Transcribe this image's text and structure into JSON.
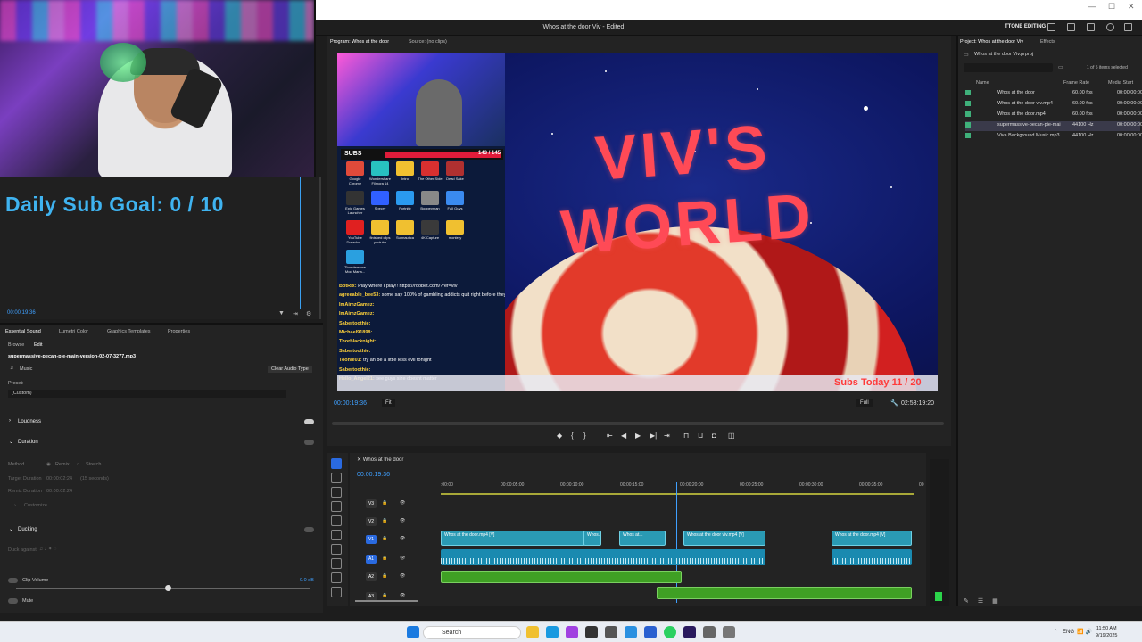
{
  "webcam": {
    "logo_text": "SUBGOAL"
  },
  "left_overlay": {
    "sub_goal": "Daily Sub Goal:  0 / 10",
    "timecode": "00:00:19:36"
  },
  "window": {
    "title": "Whos at the door Viv - Edited",
    "workspace": "TTONE EDITING"
  },
  "program": {
    "tab_program": "Program: Whos at the door",
    "tab_source": "Source: (no clips)",
    "timecode": "00:00:19:36",
    "fit": "Fit",
    "quality": "Full",
    "duration": "02:53:19:20"
  },
  "video_overlay": {
    "title_text": "VIV'S WORLD",
    "subs_label": "SUBS",
    "subs_count": "143 / 145",
    "subs_today": "Subs Today  11 / 20",
    "desktop_icons": [
      {
        "label": "Google Chrome",
        "color": "#e04a3a"
      },
      {
        "label": "Wondershare Filmora 14",
        "color": "#28c0c0"
      },
      {
        "label": "Intro",
        "color": "#f0c030"
      },
      {
        "label": "The Other Side",
        "color": "#d83030"
      },
      {
        "label": "Dead Sake",
        "color": "#b03030"
      },
      {
        "label": "Epic Games Launcher",
        "color": "#333"
      },
      {
        "label": "Specry",
        "color": "#3060ff"
      },
      {
        "label": "Fortnite",
        "color": "#2a9af0"
      },
      {
        "label": "Boogeyman",
        "color": "#888"
      },
      {
        "label": "Fall Guys",
        "color": "#3a8af0"
      },
      {
        "label": "YouTube Downloa...",
        "color": "#e02020"
      },
      {
        "label": "finished clips youtube",
        "color": "#f0c030"
      },
      {
        "label": "Subnautica",
        "color": "#f0c030"
      },
      {
        "label": "4K Capture",
        "color": "#3a3a3a"
      },
      {
        "label": "montery",
        "color": "#f0c030"
      },
      {
        "label": "Thunderstore Mod Mana...",
        "color": "#2aa0e0"
      }
    ],
    "chat": [
      {
        "user": "BotRix",
        "msg": "Play where I play!! https://roobet.com/?ref=viv"
      },
      {
        "user": "agreeable_bee53",
        "msg": "some say 100% of gambling addicts quit right before they win big"
      },
      {
        "user": "ImAimzGamez",
        "msg": ""
      },
      {
        "user": "ImAimzGamez",
        "msg": ""
      },
      {
        "user": "Sabertoothie",
        "msg": ""
      },
      {
        "user": "Michael91898",
        "msg": ""
      },
      {
        "user": "Thorblacknight",
        "msg": ""
      },
      {
        "user": "Sabertoothie",
        "msg": ""
      },
      {
        "user": "Toonle01",
        "msg": "try an be a little less evil tonight"
      },
      {
        "user": "Sabertoothie",
        "msg": ""
      },
      {
        "user": "Hello_Angel21",
        "msg": "see guys size doesnt matter"
      }
    ]
  },
  "project": {
    "tab": "Project: Whos at the door Viv",
    "tab_effects": "Effects",
    "file": "Whos at the door Viv.prproj",
    "selection": "1 of 5 items selected",
    "col_name": "Name",
    "col_rate": "Frame Rate",
    "col_start": "Media Start",
    "items": [
      {
        "name": "Whos at the door",
        "rate": "60.00 fps",
        "start": "00:00:00:00"
      },
      {
        "name": "Whos at the door viv.mp4",
        "rate": "60.00 fps",
        "start": "00:00:00:00"
      },
      {
        "name": "Whos at the door.mp4",
        "rate": "60.00 fps",
        "start": "00:00:00:00"
      },
      {
        "name": "supermassive-pecan-pie-mai",
        "rate": "44100 Hz",
        "start": "00:00:00:00"
      },
      {
        "name": "Viva Background Music.mp3",
        "rate": "44100 Hz",
        "start": "00:00:00:00"
      }
    ]
  },
  "essential_sound": {
    "tabs": [
      "Essential Sound",
      "Lumetri Color",
      "Graphics Templates",
      "Properties"
    ],
    "subtab_browse": "Browse",
    "subtab_edit": "Edit",
    "clip_name": "supermassive-pecan-pie-main-version-02-07-3277.mp3",
    "type": "Music",
    "clear_btn": "Clear Audio Type",
    "preset_label": "Preset:",
    "preset_value": "(Custom)",
    "loudness": "Loudness",
    "duration": "Duration",
    "method": "Method",
    "remix": "Remix",
    "stretch": "Stretch",
    "target_duration": "Target Duration",
    "target_val": "00:00:02:24",
    "target_sec": "(15 seconds)",
    "remix_duration": "Remix Duration",
    "remix_val": "00:00:02:24",
    "customize": "Customize",
    "ducking": "Ducking",
    "duck_against": "Duck against",
    "clip_volume": "Clip Volume",
    "clip_volume_val": "0.0 dB",
    "mute": "Mute"
  },
  "timeline": {
    "seq": "Whos at the door",
    "timecode": "00:00:19:36",
    "ruler": [
      ":00:00",
      "00:00:05:00",
      "00:00:10:00",
      "00:00:15:00",
      "00:00:20:00",
      "00:00:25:00",
      "00:00:30:00",
      "00:00:35:00",
      "00"
    ],
    "tracks": [
      "V3",
      "V2",
      "V1",
      "A1",
      "A2",
      "A3"
    ],
    "clips_v": [
      {
        "label": "Whos at the door.mp4 [V]"
      },
      {
        "label": "Whos..."
      },
      {
        "label": "Whos at..."
      },
      {
        "label": "Whos at the door viv.mp4 [V]"
      },
      {
        "label": "Whos at the door.mp4 [V]"
      }
    ]
  },
  "taskbar": {
    "search": "Search",
    "lang": "ENG",
    "time": "11:50 AM",
    "date": "9/19/2025"
  }
}
